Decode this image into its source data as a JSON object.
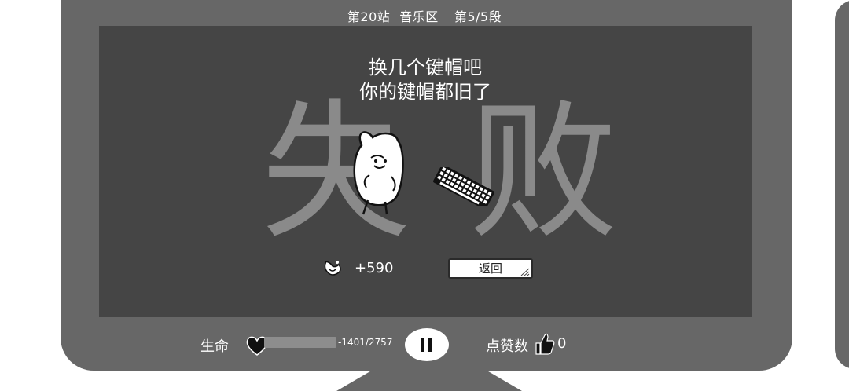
{
  "stage": {
    "station": "第20站",
    "zone": "音乐区",
    "segment": "第5/5段"
  },
  "result": {
    "big_text_left": "失",
    "big_text_right": "败",
    "message_line1": "换几个键帽吧",
    "message_line2": "你的键帽都旧了",
    "reward_value": "+590",
    "back_label": "返回"
  },
  "hud": {
    "life_label": "生命",
    "hp_text": "-1401/2757",
    "hp_fraction": 0.0,
    "likes_label": "点赞数",
    "likes_count": "0"
  },
  "icons": [
    "stamp-icon",
    "heart-icon",
    "pause-icon",
    "thumbs-up-icon",
    "keyboard-icon",
    "corner-doodle-icon"
  ],
  "colors": {
    "bezel": "#676767",
    "screen": "#454545",
    "big_text": "#8a8a8a",
    "hp_fill": "#8d8d8d"
  }
}
